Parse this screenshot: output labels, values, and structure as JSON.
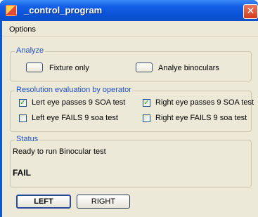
{
  "window": {
    "title": "_control_program"
  },
  "menu": {
    "options": "Options"
  },
  "analyze": {
    "legend": "Analyze",
    "fixture_only": "Fixture only",
    "analyze_binoculars": "Analye binoculars"
  },
  "resolution": {
    "legend": "Resolution evaluation by operator",
    "left_pass": {
      "label": "Lert eye passes 9 SOA test",
      "checked": true
    },
    "right_pass": {
      "label": "Right eye passes 9 SOA test",
      "checked": true
    },
    "left_fail": {
      "label": "Left eye FAILS 9 soa test",
      "checked": false
    },
    "right_fail": {
      "label": "Right eye FAILS 9 soa test",
      "checked": false
    }
  },
  "status": {
    "legend": "Status",
    "message": "Ready to run Binocular test",
    "result": "FAIL"
  },
  "buttons": {
    "left": "LEFT",
    "right": "RIGHT"
  },
  "icons": {
    "close": "close-icon",
    "app": "app-icon",
    "check": "check-icon"
  }
}
